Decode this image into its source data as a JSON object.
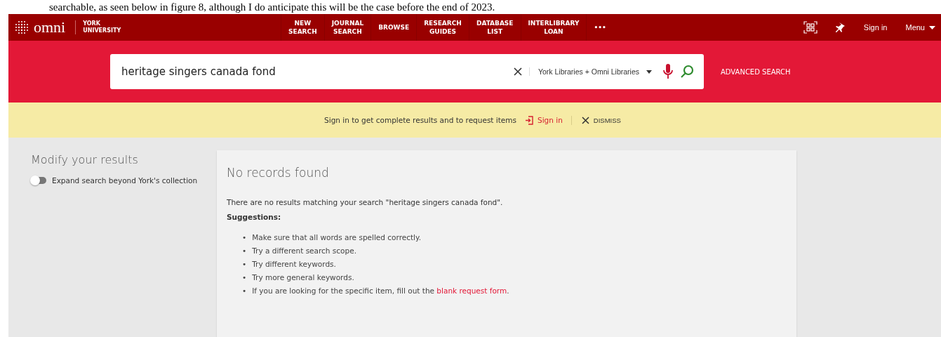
{
  "document_caption": "searchable, as seen below in figure 8, although I do anticipate this will be the case before the end of 2023.",
  "header": {
    "logo": "omni",
    "institution": "YORK\nUNIVERSITY",
    "nav": [
      {
        "label": "NEW\nSEARCH"
      },
      {
        "label": "JOURNAL\nSEARCH"
      },
      {
        "label": "BROWSE"
      },
      {
        "label": "RESEARCH\nGUIDES"
      },
      {
        "label": "DATABASE\nLIST"
      },
      {
        "label": "INTERLIBRARY\nLOAN"
      },
      {
        "label": "•••"
      }
    ],
    "sign_in": "Sign in",
    "menu": "Menu"
  },
  "search": {
    "value": "heritage singers canada fond",
    "scope": "York Libraries + Omni Libraries",
    "advanced": "ADVANCED SEARCH"
  },
  "notice": {
    "text": "Sign in to get complete results and to request items",
    "sign_in": "Sign in",
    "dismiss": "DISMISS"
  },
  "sidebar": {
    "title": "Modify your results",
    "toggle": {
      "label": "Expand search beyond York's collection",
      "on": false
    }
  },
  "results": {
    "title": "No records found",
    "message": "There are no results matching your search \"heritage singers canada fond\".",
    "suggestions_title": "Suggestions:",
    "suggestions": [
      {
        "marker": "•",
        "text": "Make sure that all words are spelled correctly."
      },
      {
        "marker": "•",
        "text": "Try a different search scope."
      },
      {
        "marker": "•",
        "text": "Try different keywords."
      },
      {
        "marker": "•",
        "text": "Try more general keywords."
      },
      {
        "marker": "•",
        "text": "If you are looking for the specific item, fill out the ",
        "link": "blank request form",
        "after": "."
      }
    ]
  }
}
